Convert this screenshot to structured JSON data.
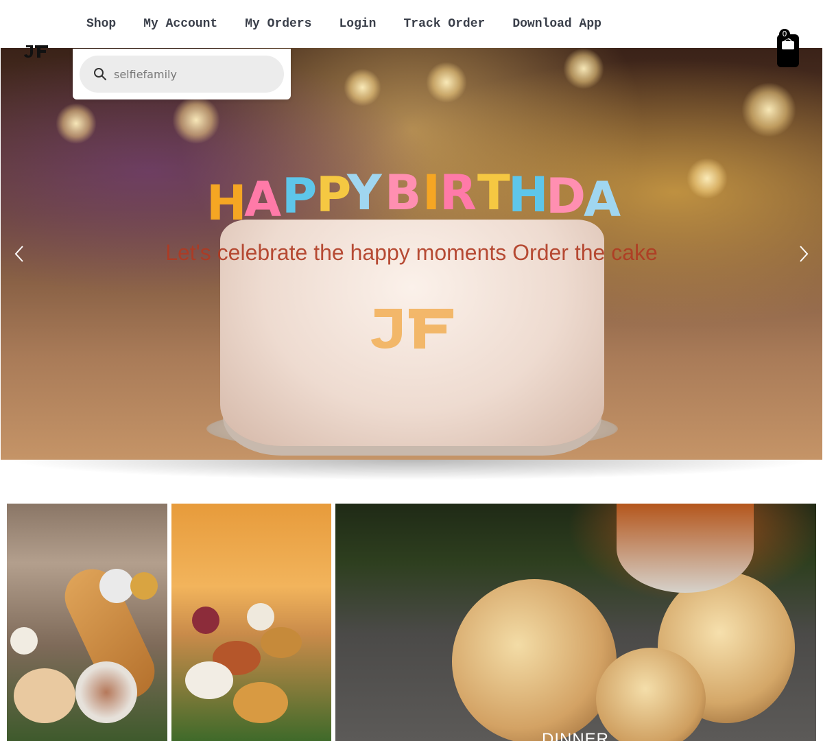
{
  "nav": {
    "items": [
      {
        "label": "Shop"
      },
      {
        "label": "My Account"
      },
      {
        "label": "My Orders"
      },
      {
        "label": "Login"
      },
      {
        "label": "Track Order"
      },
      {
        "label": "Download App"
      }
    ]
  },
  "logo": {
    "icon": "brand-logo",
    "text": "JF"
  },
  "cart": {
    "count": "0",
    "icon": "shopping-bag-icon"
  },
  "search": {
    "value": "selfiefamily",
    "icon": "search-icon"
  },
  "hero": {
    "caption": "Let's celebrate the happy moments Order the cake",
    "prev_icon": "chevron-left-icon",
    "next_icon": "chevron-right-icon",
    "caption_color": "#b03a22"
  },
  "categories": [
    {
      "label": ""
    },
    {
      "label": ""
    },
    {
      "label": "DINNER"
    }
  ]
}
